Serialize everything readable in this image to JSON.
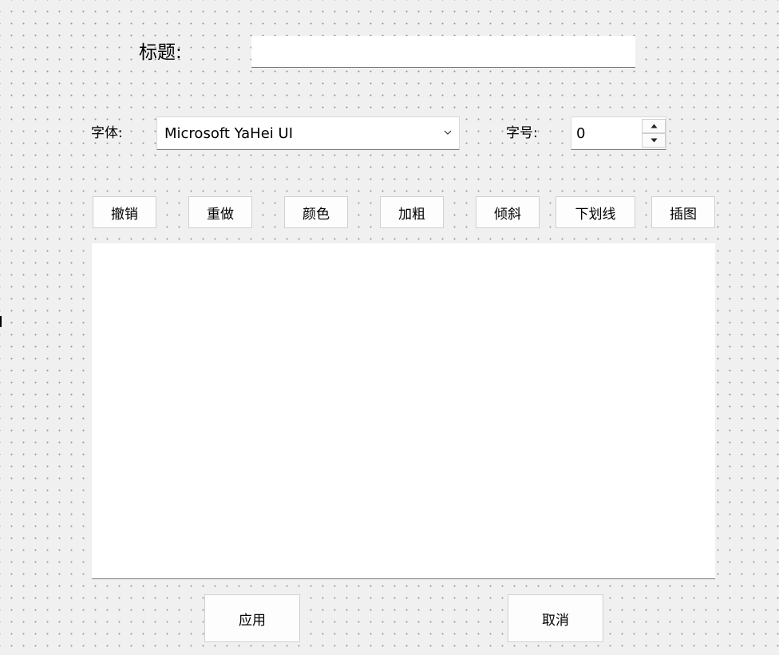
{
  "title_row": {
    "label": "标题:",
    "value": ""
  },
  "font_row": {
    "font_label": "字体:",
    "font_value": "Microsoft YaHei UI",
    "size_label": "字号:",
    "size_value": "0"
  },
  "toolbar": {
    "undo": "撤销",
    "redo": "重做",
    "color": "颜色",
    "bold": "加粗",
    "italic": "倾斜",
    "underline": "下划线",
    "insert_image": "插图"
  },
  "editor": {
    "content": ""
  },
  "footer": {
    "apply": "应用",
    "cancel": "取消"
  }
}
